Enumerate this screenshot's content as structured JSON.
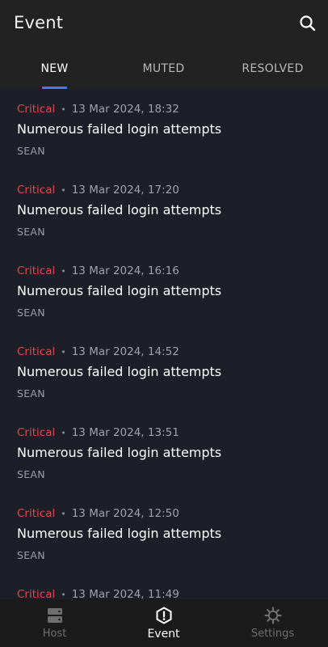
{
  "header": {
    "title": "Event"
  },
  "tabs": [
    {
      "label": "NEW"
    },
    {
      "label": "MUTED"
    },
    {
      "label": "RESOLVED"
    }
  ],
  "events": [
    {
      "severity": "Critical",
      "timestamp": "13 Mar 2024, 18:32",
      "title": "Numerous failed login attempts",
      "host": "SEAN"
    },
    {
      "severity": "Critical",
      "timestamp": "13 Mar 2024, 17:20",
      "title": "Numerous failed login attempts",
      "host": "SEAN"
    },
    {
      "severity": "Critical",
      "timestamp": "13 Mar 2024, 16:16",
      "title": "Numerous failed login attempts",
      "host": "SEAN"
    },
    {
      "severity": "Critical",
      "timestamp": "13 Mar 2024, 14:52",
      "title": "Numerous failed login attempts",
      "host": "SEAN"
    },
    {
      "severity": "Critical",
      "timestamp": "13 Mar 2024, 13:51",
      "title": "Numerous failed login attempts",
      "host": "SEAN"
    },
    {
      "severity": "Critical",
      "timestamp": "13 Mar 2024, 12:50",
      "title": "Numerous failed login attempts",
      "host": "SEAN"
    },
    {
      "severity": "Critical",
      "timestamp": "13 Mar 2024, 11:49",
      "title": "",
      "host": ""
    }
  ],
  "bottom_nav": [
    {
      "label": "Host",
      "icon": "server-icon"
    },
    {
      "label": "Event",
      "icon": "alert-shield-icon"
    },
    {
      "label": "Settings",
      "icon": "gear-icon"
    }
  ],
  "colors": {
    "background": "#1c1f27",
    "bar": "#222222",
    "accent": "#3d7cf2",
    "critical": "#e0474f"
  }
}
